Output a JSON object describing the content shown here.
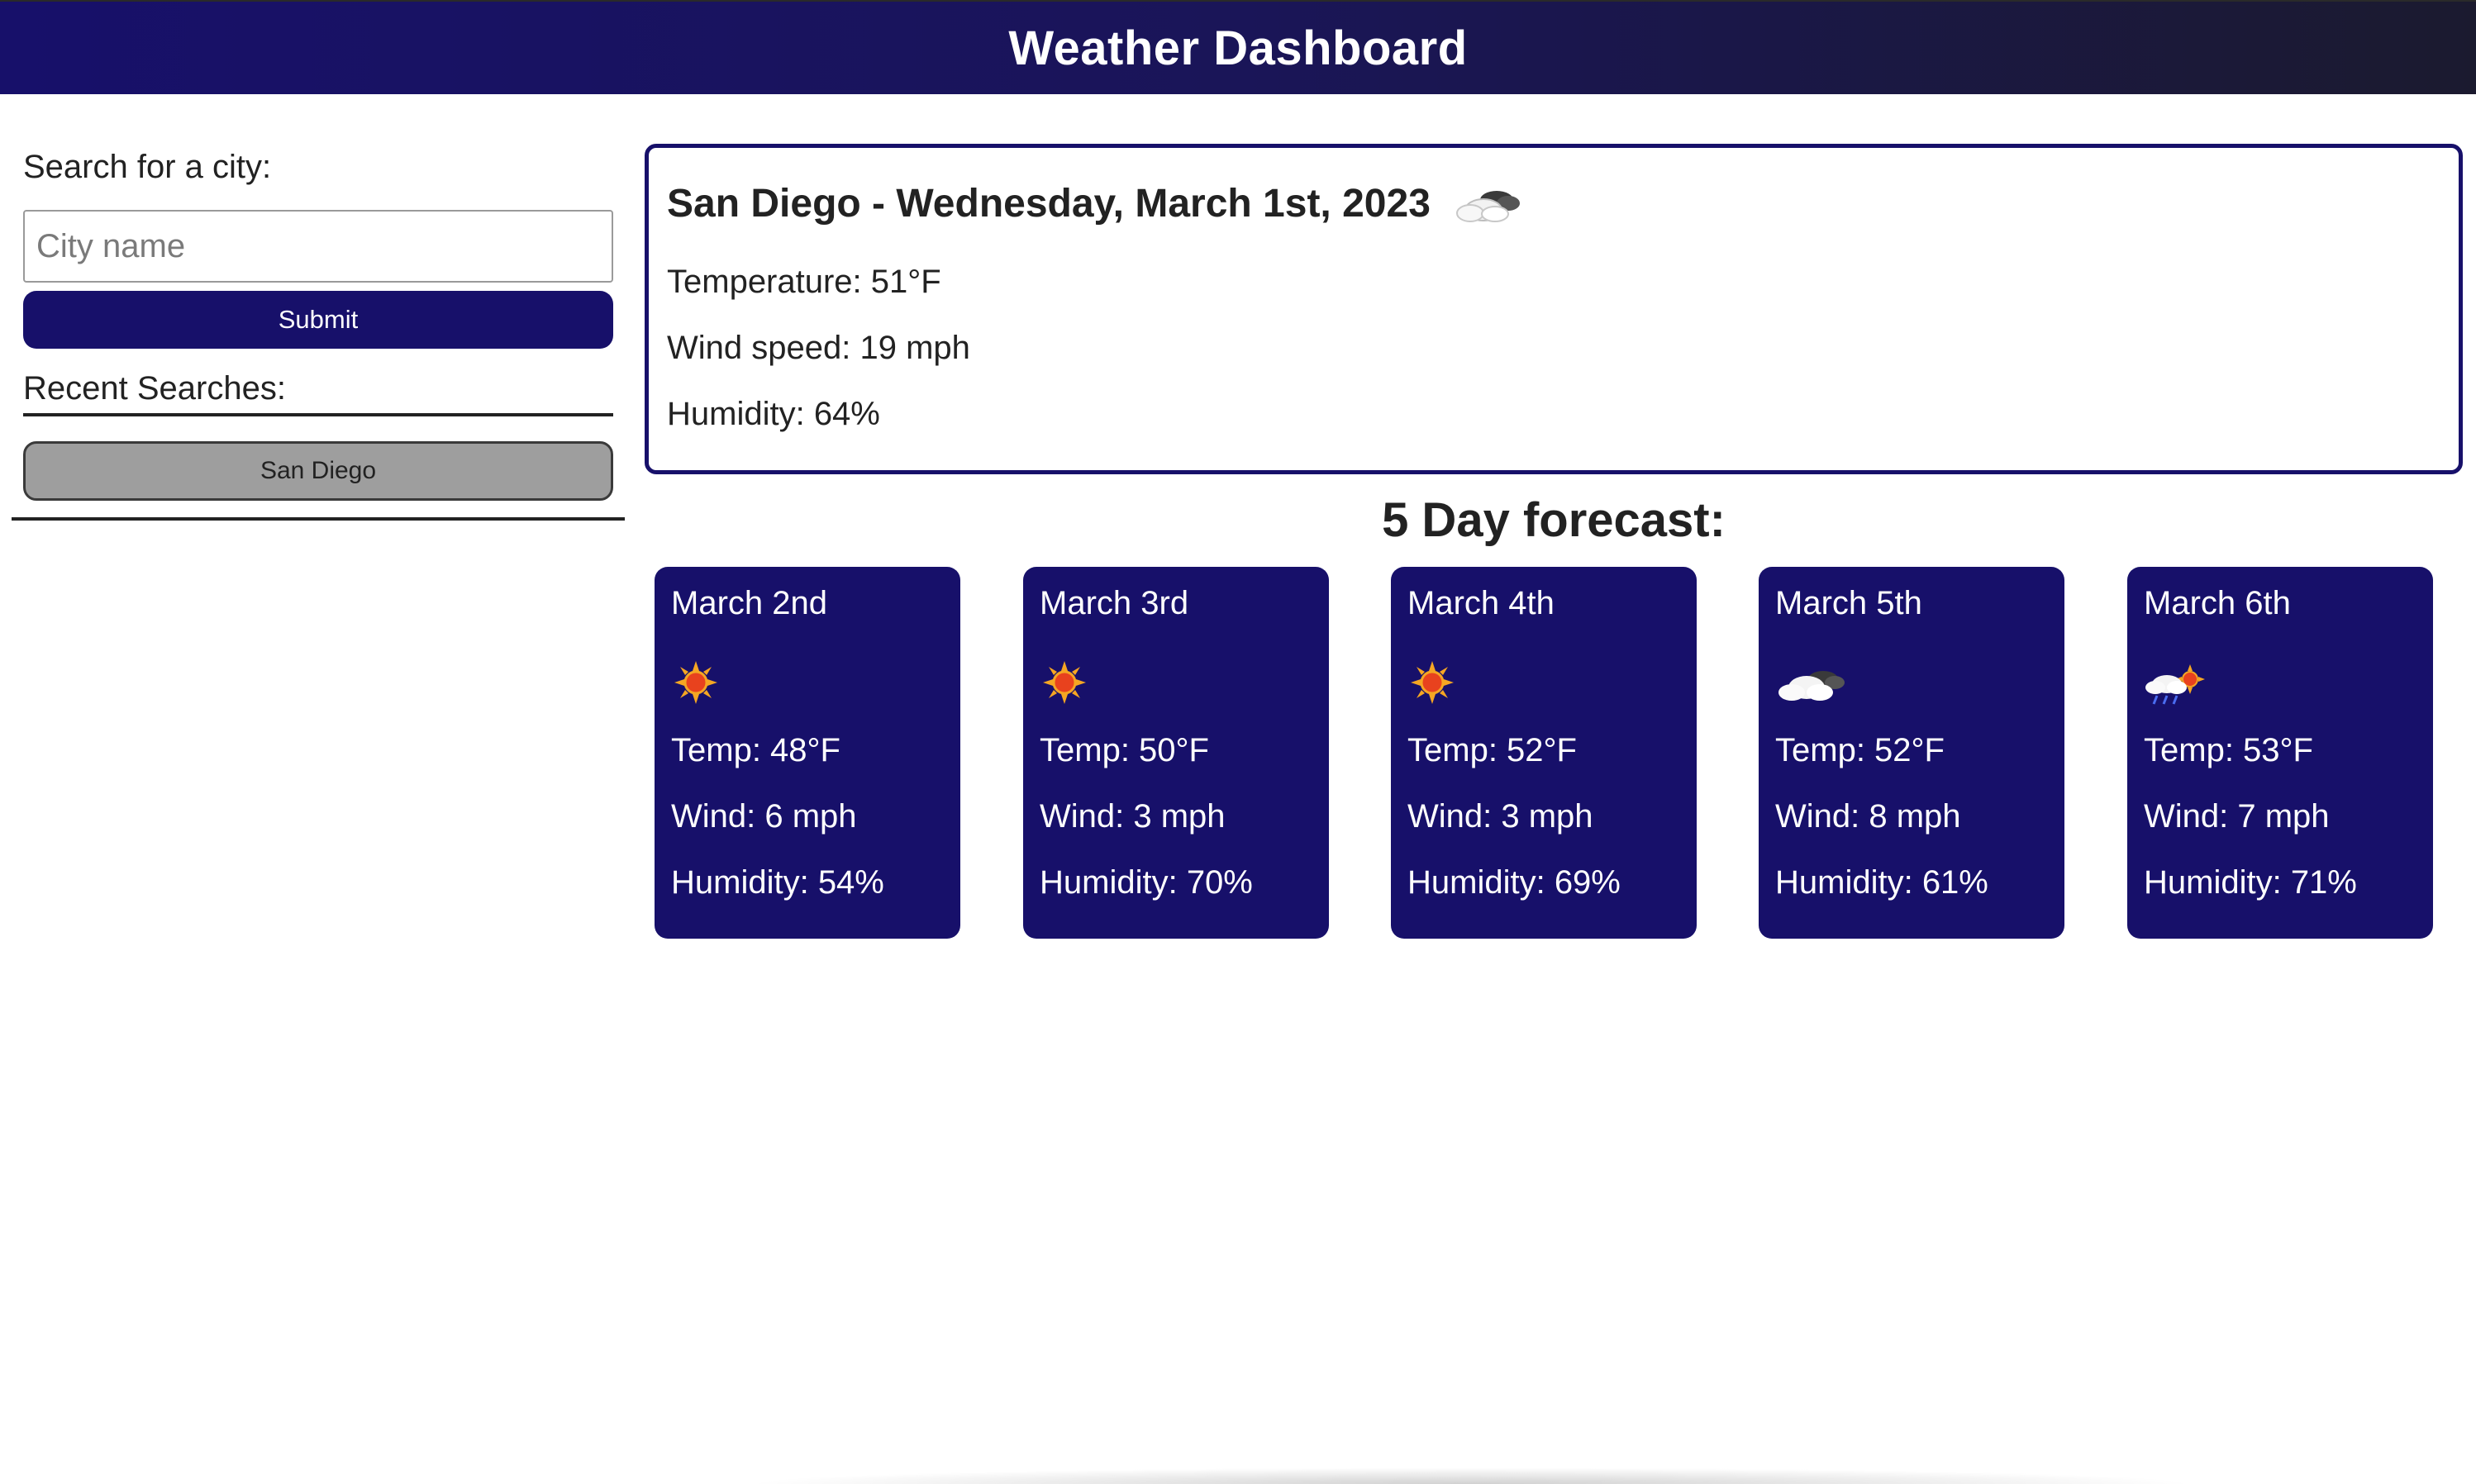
{
  "header": {
    "title": "Weather Dashboard"
  },
  "sidebar": {
    "search_label": "Search for a city:",
    "search_placeholder": "City name",
    "search_value": "",
    "submit_label": "Submit",
    "recent_label": "Recent Searches:",
    "recent_items": [
      "San Diego"
    ]
  },
  "current": {
    "title": "San Diego - Wednesday, March 1st, 2023",
    "icon": "partly-cloudy-icon",
    "temperature": "Temperature: 51°F",
    "wind": "Wind speed: 19 mph",
    "humidity": "Humidity: 64%"
  },
  "forecast": {
    "heading": "5 Day forecast:",
    "days": [
      {
        "date": "March 2nd",
        "icon": "sun-icon",
        "temp": "Temp: 48°F",
        "wind": "Wind: 6 mph",
        "humidity": "Humidity: 54%"
      },
      {
        "date": "March 3rd",
        "icon": "sun-icon",
        "temp": "Temp: 50°F",
        "wind": "Wind: 3 mph",
        "humidity": "Humidity: 70%"
      },
      {
        "date": "March 4th",
        "icon": "sun-icon",
        "temp": "Temp: 52°F",
        "wind": "Wind: 3 mph",
        "humidity": "Humidity: 69%"
      },
      {
        "date": "March 5th",
        "icon": "cloud-icon",
        "temp": "Temp: 52°F",
        "wind": "Wind: 8 mph",
        "humidity": "Humidity: 61%"
      },
      {
        "date": "March 6th",
        "icon": "rain-sun-icon",
        "temp": "Temp: 53°F",
        "wind": "Wind: 7 mph",
        "humidity": "Humidity: 71%"
      }
    ]
  },
  "colors": {
    "primary": "#17106a",
    "recent_button": "#9e9e9e",
    "text": "#222222"
  }
}
